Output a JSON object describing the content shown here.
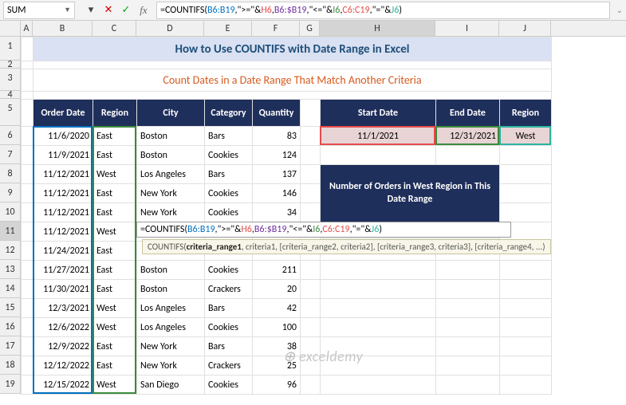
{
  "name_box": "SUM",
  "formula_text": "=COUNTIFS(B6:B19,\">=\"&H6,B6:$B19,\"<=\"&I6,C6:C19,\"=\"&J6)",
  "formula_parts": {
    "prefix": "=COUNTIFS(",
    "r1": "B6:B19",
    "c1": ",\">=\"&",
    "a1": "H6",
    "c2": ",",
    "r2": "B6:$B19",
    "c3": ",\"<=\"&",
    "a2": "I6",
    "c4": ",",
    "r3": "C6:C19",
    "c5": ",\"=\"&",
    "a3": "J6",
    "suffix": ")"
  },
  "col_headers": [
    "A",
    "B",
    "C",
    "D",
    "E",
    "F",
    "G",
    "H",
    "I",
    "J"
  ],
  "row_numbers": [
    1,
    2,
    3,
    4,
    5,
    6,
    7,
    8,
    9,
    10,
    11,
    12,
    13,
    14,
    15,
    16,
    17,
    18,
    19
  ],
  "title": "How to Use COUNTIFS with Date Range in Excel",
  "subtitle": "Count Dates in a Date Range That Match Another Criteria",
  "table_hdr": [
    "Order Date",
    "Region",
    "City",
    "Category",
    "Quantity"
  ],
  "crit_hdr": [
    "Start Date",
    "End Date",
    "Region"
  ],
  "crit_vals": [
    "11/1/2021",
    "12/31/2021",
    "West"
  ],
  "result_label": "Number of Orders in West Region in This Date Range",
  "rows": [
    {
      "date": "11/6/2020",
      "region": "East",
      "city": "Boston",
      "cat": "Bars",
      "qty": "83"
    },
    {
      "date": "11/9/2021",
      "region": "East",
      "city": "Boston",
      "cat": "Cookies",
      "qty": "124"
    },
    {
      "date": "11/12/2021",
      "region": "West",
      "city": "Los Angeles",
      "cat": "Bars",
      "qty": "137"
    },
    {
      "date": "11/12/2021",
      "region": "East",
      "city": "New York",
      "cat": "Cookies",
      "qty": "146"
    },
    {
      "date": "11/12/2021",
      "region": "East",
      "city": "New York",
      "cat": "Cookies",
      "qty": "34"
    },
    {
      "date": "11/12/2021",
      "region": "West",
      "city": "",
      "cat": "",
      "qty": ""
    },
    {
      "date": "11/24/2021",
      "region": "East",
      "city": "",
      "cat": "",
      "qty": ""
    },
    {
      "date": "11/27/2021",
      "region": "East",
      "city": "Boston",
      "cat": "Cookies",
      "qty": "211"
    },
    {
      "date": "11/30/2021",
      "region": "East",
      "city": "Boston",
      "cat": "Crackers",
      "qty": "20"
    },
    {
      "date": "12/3/2021",
      "region": "West",
      "city": "Los Angeles",
      "cat": "Bars",
      "qty": "42"
    },
    {
      "date": "12/6/2022",
      "region": "West",
      "city": "Los Angeles",
      "cat": "Cookies",
      "qty": "100"
    },
    {
      "date": "12/9/2022",
      "region": "East",
      "city": "New York",
      "cat": "Bars",
      "qty": "38"
    },
    {
      "date": "12/12/2022",
      "region": "East",
      "city": "New York",
      "cat": "Crackers",
      "qty": "25"
    },
    {
      "date": "12/15/2022",
      "region": "West",
      "city": "San Diego",
      "cat": "Cookies",
      "qty": "96"
    }
  ],
  "hint": {
    "fn": "COUNTIFS(",
    "args": "criteria_range1, criteria1, [criteria_range2, criteria2], [criteria_range3, criteria3], [criteria_range4, ...)"
  },
  "watermark": "exceldemy"
}
